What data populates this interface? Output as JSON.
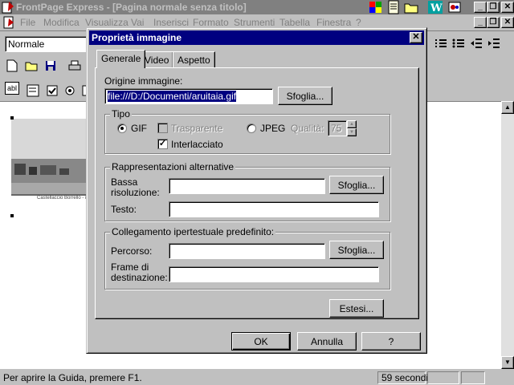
{
  "app": {
    "title": "FrontPage Express - [Pagina normale senza titolo]"
  },
  "menu": {
    "items": [
      "File",
      "Modifica",
      "Visualizza",
      "Vai",
      "Inserisci",
      "Formato",
      "Strumenti",
      "Tabella",
      "Finestra",
      "?"
    ]
  },
  "toolbar": {
    "style_value": "Normale"
  },
  "image_preview": {
    "caption": "Castellaccio Borrello - il"
  },
  "statusbar": {
    "help_text": "Per aprire la Guida, premere F1.",
    "time_text": "59 secondi"
  },
  "dialog": {
    "title": "Proprietà immagine",
    "close_glyph": "✕",
    "tabs": [
      "Generale",
      "Video",
      "Aspetto"
    ],
    "origin": {
      "label": "Origine immagine:",
      "value": "file:///D:/Documenti/aruitaia.gif",
      "browse_label": "Sfoglia..."
    },
    "tipo": {
      "legend": "Tipo",
      "gif_label": "GIF",
      "gif_selected": true,
      "transparent_label": "Trasparente",
      "interlaced_label": "Interlacciato",
      "interlaced_checked": true,
      "jpeg_label": "JPEG",
      "quality_label": "Qualità:",
      "quality_value": "75"
    },
    "alternatives": {
      "legend": "Rappresentazioni alternative",
      "low_res_label_line1": "Bassa",
      "low_res_label_line2": "risoluzione:",
      "low_res_value": "",
      "browse_label": "Sfoglia...",
      "text_label": "Testo:",
      "text_value": ""
    },
    "hyperlink": {
      "legend": "Collegamento ipertestuale predefinito:",
      "path_label": "Percorso:",
      "path_value": "",
      "browse_label": "Sfoglia...",
      "frame_label_line1": "Frame di",
      "frame_label_line2": "destinazione:",
      "frame_value": ""
    },
    "extended_label": "Estesi...",
    "ok_label": "OK",
    "cancel_label": "Annulla",
    "help_label": "?"
  },
  "colors": {
    "dialog_title_active": "#000080",
    "window_title_inactive": "#808080",
    "face": "#c0c0c0"
  }
}
